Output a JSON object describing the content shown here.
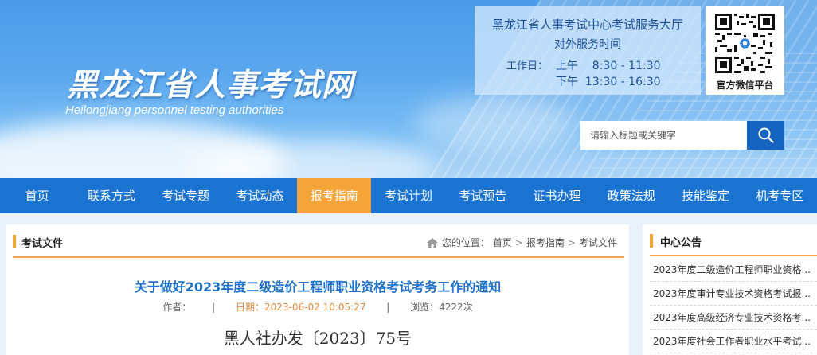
{
  "header": {
    "site_title": "黑龙江省人事考试网",
    "site_subtitle": "Heilongjiang personnel testing authorities",
    "service": {
      "title": "黑龙江省人事考试中心考试服务大厅",
      "subtitle": "对外服务时间",
      "worktime_label": "工作日：",
      "morning": "上午    8:30 - 11:30",
      "afternoon": "下午  13:30 - 16:30"
    },
    "qr_caption": "官方微信平台",
    "search": {
      "placeholder": "请输入标题或关键字",
      "icon": "search-icon"
    }
  },
  "nav": {
    "items": [
      {
        "label": "首页"
      },
      {
        "label": "联系方式"
      },
      {
        "label": "考试专题"
      },
      {
        "label": "考试动态"
      },
      {
        "label": "报考指南",
        "active": true
      },
      {
        "label": "考试计划"
      },
      {
        "label": "考试预告"
      },
      {
        "label": "证书办理"
      },
      {
        "label": "政策法规"
      },
      {
        "label": "技能鉴定"
      },
      {
        "label": "机考专区"
      }
    ],
    "active_color": "#f5a43a",
    "bar_color": "#1b73d1"
  },
  "content": {
    "section_title": "考试文件",
    "breadcrumb": {
      "prefix": "您的位置：",
      "items": [
        "首页",
        "报考指南",
        "考试文件"
      ],
      "separator": ">"
    },
    "article": {
      "title": "关于做好2023年度二级造价工程师职业资格考试考务工作的通知",
      "author": "作者：",
      "date": "日期：2023-06-02 10:05:27",
      "views": "浏览：4222次",
      "meta_separator": "|",
      "doc_number": "黑人社办发〔2023〕75号"
    }
  },
  "sidebar": {
    "title": "中心公告",
    "notices": [
      "2023年度二级造价工程师职业资格...",
      "2023年度审计专业技术资格考试报...",
      "2023年度高级经济专业技术资格考...",
      "2023年度社会工作者职业水平考试..."
    ]
  }
}
